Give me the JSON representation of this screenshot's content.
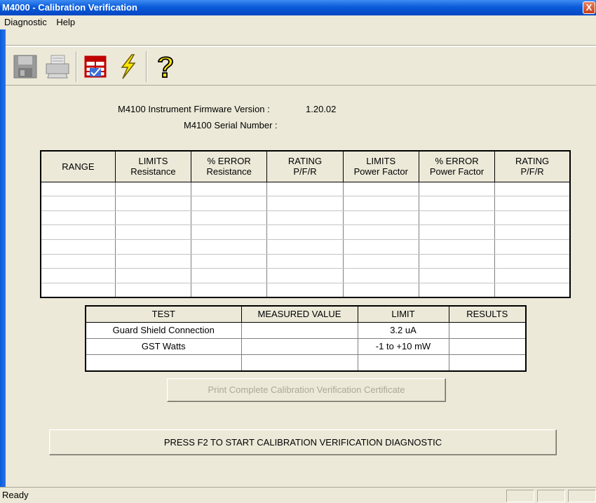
{
  "window": {
    "title": "M4000 - Calibration Verification",
    "close_glyph": "X"
  },
  "menu": {
    "items": [
      "Diagnostic",
      "Help"
    ]
  },
  "toolbar": {
    "icons": [
      "save-icon",
      "print-icon",
      "calibration-sheet-icon",
      "lightning-icon",
      "help-icon"
    ]
  },
  "info": {
    "firmware_label": "M4100 Instrument Firmware Version :",
    "firmware_value": "1.20.02",
    "serial_label": "M4100 Serial Number :",
    "serial_value": ""
  },
  "range_table": {
    "headers": [
      [
        "RANGE",
        ""
      ],
      [
        "LIMITS",
        "Resistance"
      ],
      [
        "% ERROR",
        "Resistance"
      ],
      [
        "RATING",
        "P/F/R"
      ],
      [
        "LIMITS",
        "Power Factor"
      ],
      [
        "% ERROR",
        "Power Factor"
      ],
      [
        "RATING",
        "P/F/R"
      ]
    ],
    "rows": [
      [
        "",
        "",
        "",
        "",
        "",
        "",
        ""
      ],
      [
        "",
        "",
        "",
        "",
        "",
        "",
        ""
      ],
      [
        "",
        "",
        "",
        "",
        "",
        "",
        ""
      ],
      [
        "",
        "",
        "",
        "",
        "",
        "",
        ""
      ],
      [
        "",
        "",
        "",
        "",
        "",
        "",
        ""
      ],
      [
        "",
        "",
        "",
        "",
        "",
        "",
        ""
      ],
      [
        "",
        "",
        "",
        "",
        "",
        "",
        ""
      ],
      [
        "",
        "",
        "",
        "",
        "",
        "",
        ""
      ]
    ]
  },
  "test_table": {
    "headers": [
      "TEST",
      "MEASURED VALUE",
      "LIMIT",
      "RESULTS"
    ],
    "rows": [
      [
        "Guard Shield Connection",
        "",
        "3.2 uA",
        ""
      ],
      [
        "GST Watts",
        "",
        "-1 to +10 mW",
        ""
      ],
      [
        "",
        "",
        "",
        ""
      ]
    ]
  },
  "buttons": {
    "print_certificate": "Print Complete Calibration Verification Certificate",
    "start_diagnostic": "PRESS F2 TO START CALIBRATION VERIFICATION DIAGNOSTIC"
  },
  "status": {
    "text": "Ready"
  },
  "colors": {
    "titlebar": "#0a5bd9",
    "face": "#ece9d8",
    "disabled_text": "#aca899"
  }
}
